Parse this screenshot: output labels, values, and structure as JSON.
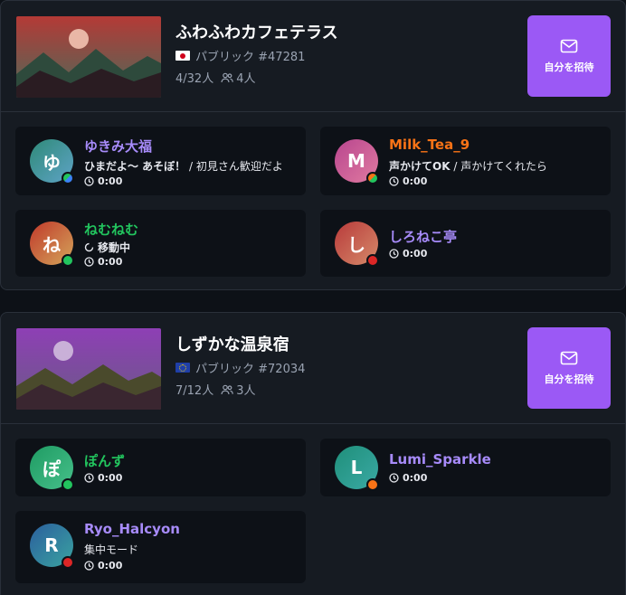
{
  "instances": [
    {
      "title": "ふわふわカフェテラス",
      "visibility": "パブリック #47281",
      "flag": "jp",
      "capacity": "4/32人",
      "friends": "4人",
      "invite_label": "自分を招待",
      "members": [
        {
          "initial": "ゆ",
          "name": "ゆきみ大福",
          "name_color": "#a78bfa",
          "status_bold": "ひまだよ～ あそぼ！",
          "status_sep": " / ",
          "status_text": "初見さん歓迎だよ",
          "time": "0:00",
          "dot": "split-blue-green"
        },
        {
          "initial": "M",
          "name": "Milk_Tea_9",
          "name_color": "#f97316",
          "status_bold": "声かけてOK",
          "status_sep": " / ",
          "status_text": "声かけてくれたら",
          "time": "0:00",
          "dot": "split-orange-green"
        },
        {
          "initial": "ね",
          "name": "ねむねむ",
          "name_color": "#22c55e",
          "status_bold": "移動中",
          "status_sep": "",
          "status_text": "",
          "time": "0:00",
          "dot": "green"
        },
        {
          "initial": "し",
          "name": "しろねこ亭",
          "name_color": "#a78bfa",
          "status_bold": "",
          "status_sep": "",
          "status_text": "",
          "time": "0:00",
          "dot": "red"
        }
      ]
    },
    {
      "title": "しずかな温泉宿",
      "visibility": "パブリック #72034",
      "flag": "eu",
      "capacity": "7/12人",
      "friends": "3人",
      "invite_label": "自分を招待",
      "members": [
        {
          "initial": "ぽ",
          "name": "ぽんず",
          "name_color": "#22c55e",
          "status_bold": "",
          "status_sep": "",
          "status_text": "",
          "time": "0:00",
          "dot": "green"
        },
        {
          "initial": "L",
          "name": "Lumi_Sparkle",
          "name_color": "#a78bfa",
          "status_bold": "",
          "status_sep": "",
          "status_text": "",
          "time": "0:00",
          "dot": "orange"
        },
        {
          "initial": "R",
          "name": "Ryo_Halcyon",
          "name_color": "#a78bfa",
          "status_bold": "",
          "status_sep": "",
          "status_text": "集中モード",
          "time": "0:00",
          "dot": "red"
        }
      ]
    }
  ],
  "colors": {
    "accent": "#9b59f5",
    "online": "#22c55e",
    "busy": "#dc2626",
    "away": "#f97316",
    "ask": "#3b82f6"
  },
  "icons": [
    "mail-icon",
    "friends-icon",
    "clock-icon",
    "loading-icon"
  ]
}
